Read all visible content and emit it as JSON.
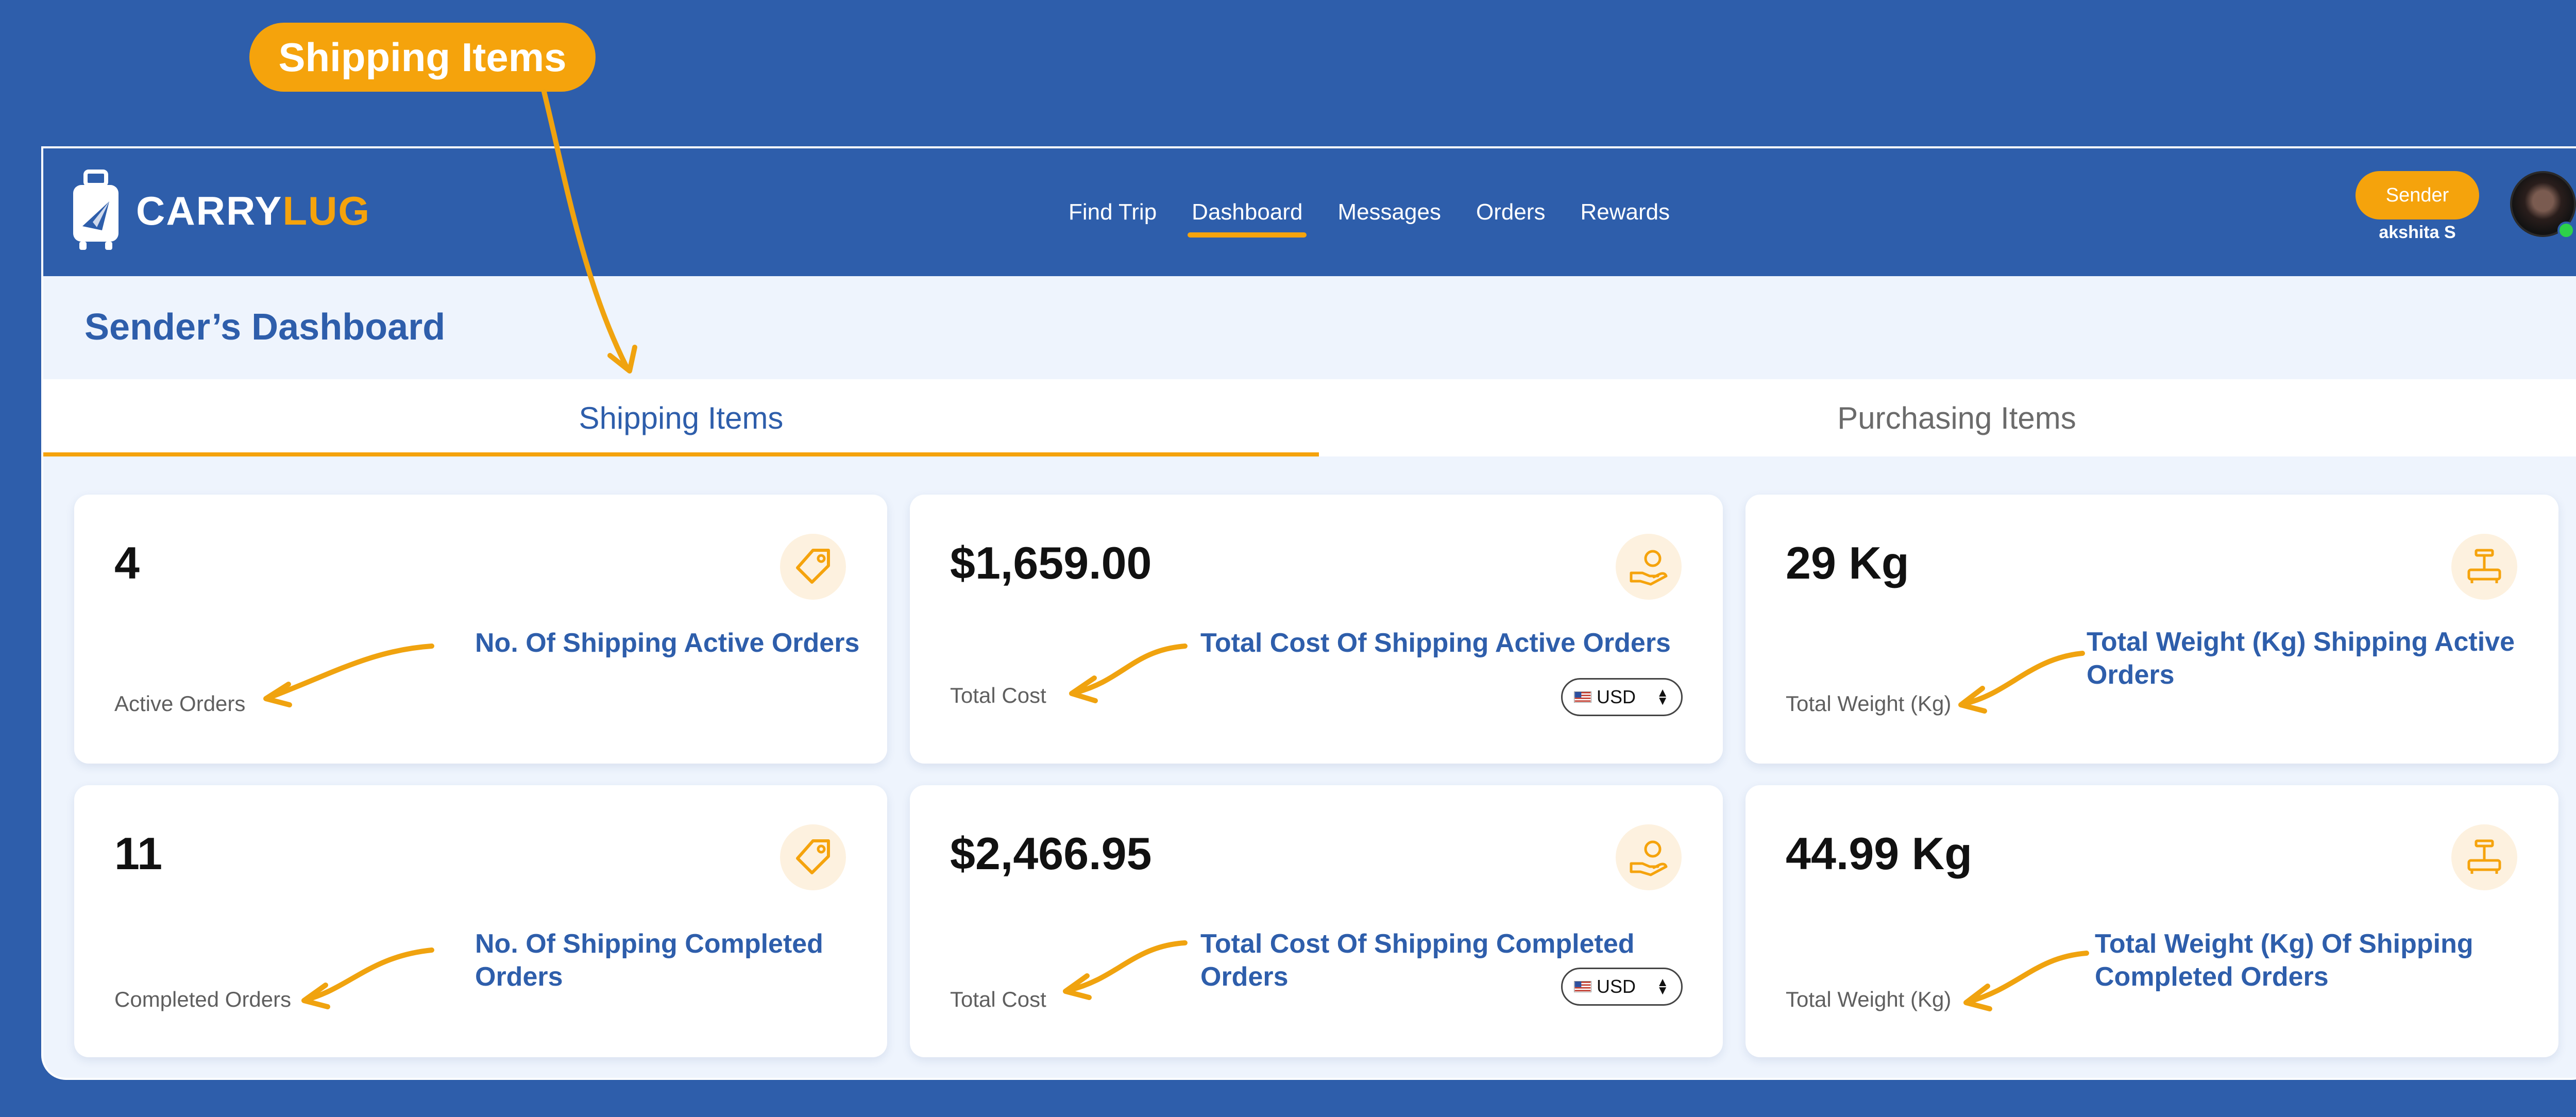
{
  "callout": {
    "label": "Shipping Items"
  },
  "brand": {
    "name_part1": "CARRY",
    "name_part2": "LUG"
  },
  "nav": {
    "items": [
      "Find Trip",
      "Dashboard",
      "Messages",
      "Orders",
      "Rewards"
    ],
    "active": "Dashboard"
  },
  "user": {
    "role": "Sender",
    "name": "akshita S",
    "status": "online"
  },
  "page": {
    "title": "Sender’s Dashboard"
  },
  "tabs": [
    {
      "label": "Shipping Items",
      "active": true
    },
    {
      "label": "Purchasing Items",
      "active": false
    }
  ],
  "cards": [
    {
      "value": "4",
      "label": "Active Orders",
      "note": "No. Of Shipping Active Orders",
      "icon": "tag-icon"
    },
    {
      "value": "$1,659.00",
      "label": "Total Cost",
      "note": "Total Cost Of Shipping Active Orders",
      "icon": "money-hand-icon",
      "currency": "USD"
    },
    {
      "value": "29 Kg",
      "label": "Total Weight (Kg)",
      "note_line1": "Total Weight (Kg) Shipping Active",
      "note_line2": "Orders",
      "icon": "weight-scale-icon"
    },
    {
      "value": "11",
      "label": "Completed Orders",
      "note_line1": "No. Of Shipping Completed",
      "note_line2": "Orders",
      "icon": "tag-icon"
    },
    {
      "value": "$2,466.95",
      "label": "Total Cost",
      "note_line1": "Total Cost Of Shipping Completed",
      "note_line2": "Orders",
      "icon": "money-hand-icon",
      "currency": "USD"
    },
    {
      "value": "44.99 Kg",
      "label": "Total Weight (Kg)",
      "note_line1": "Total Weight (Kg) Of Shipping",
      "note_line2": "Completed Orders",
      "icon": "weight-scale-icon"
    }
  ],
  "colors": {
    "primary": "#2e5eab",
    "accent": "#f5a30c",
    "page_bg": "#eef4fd",
    "online": "#2dd14a"
  }
}
